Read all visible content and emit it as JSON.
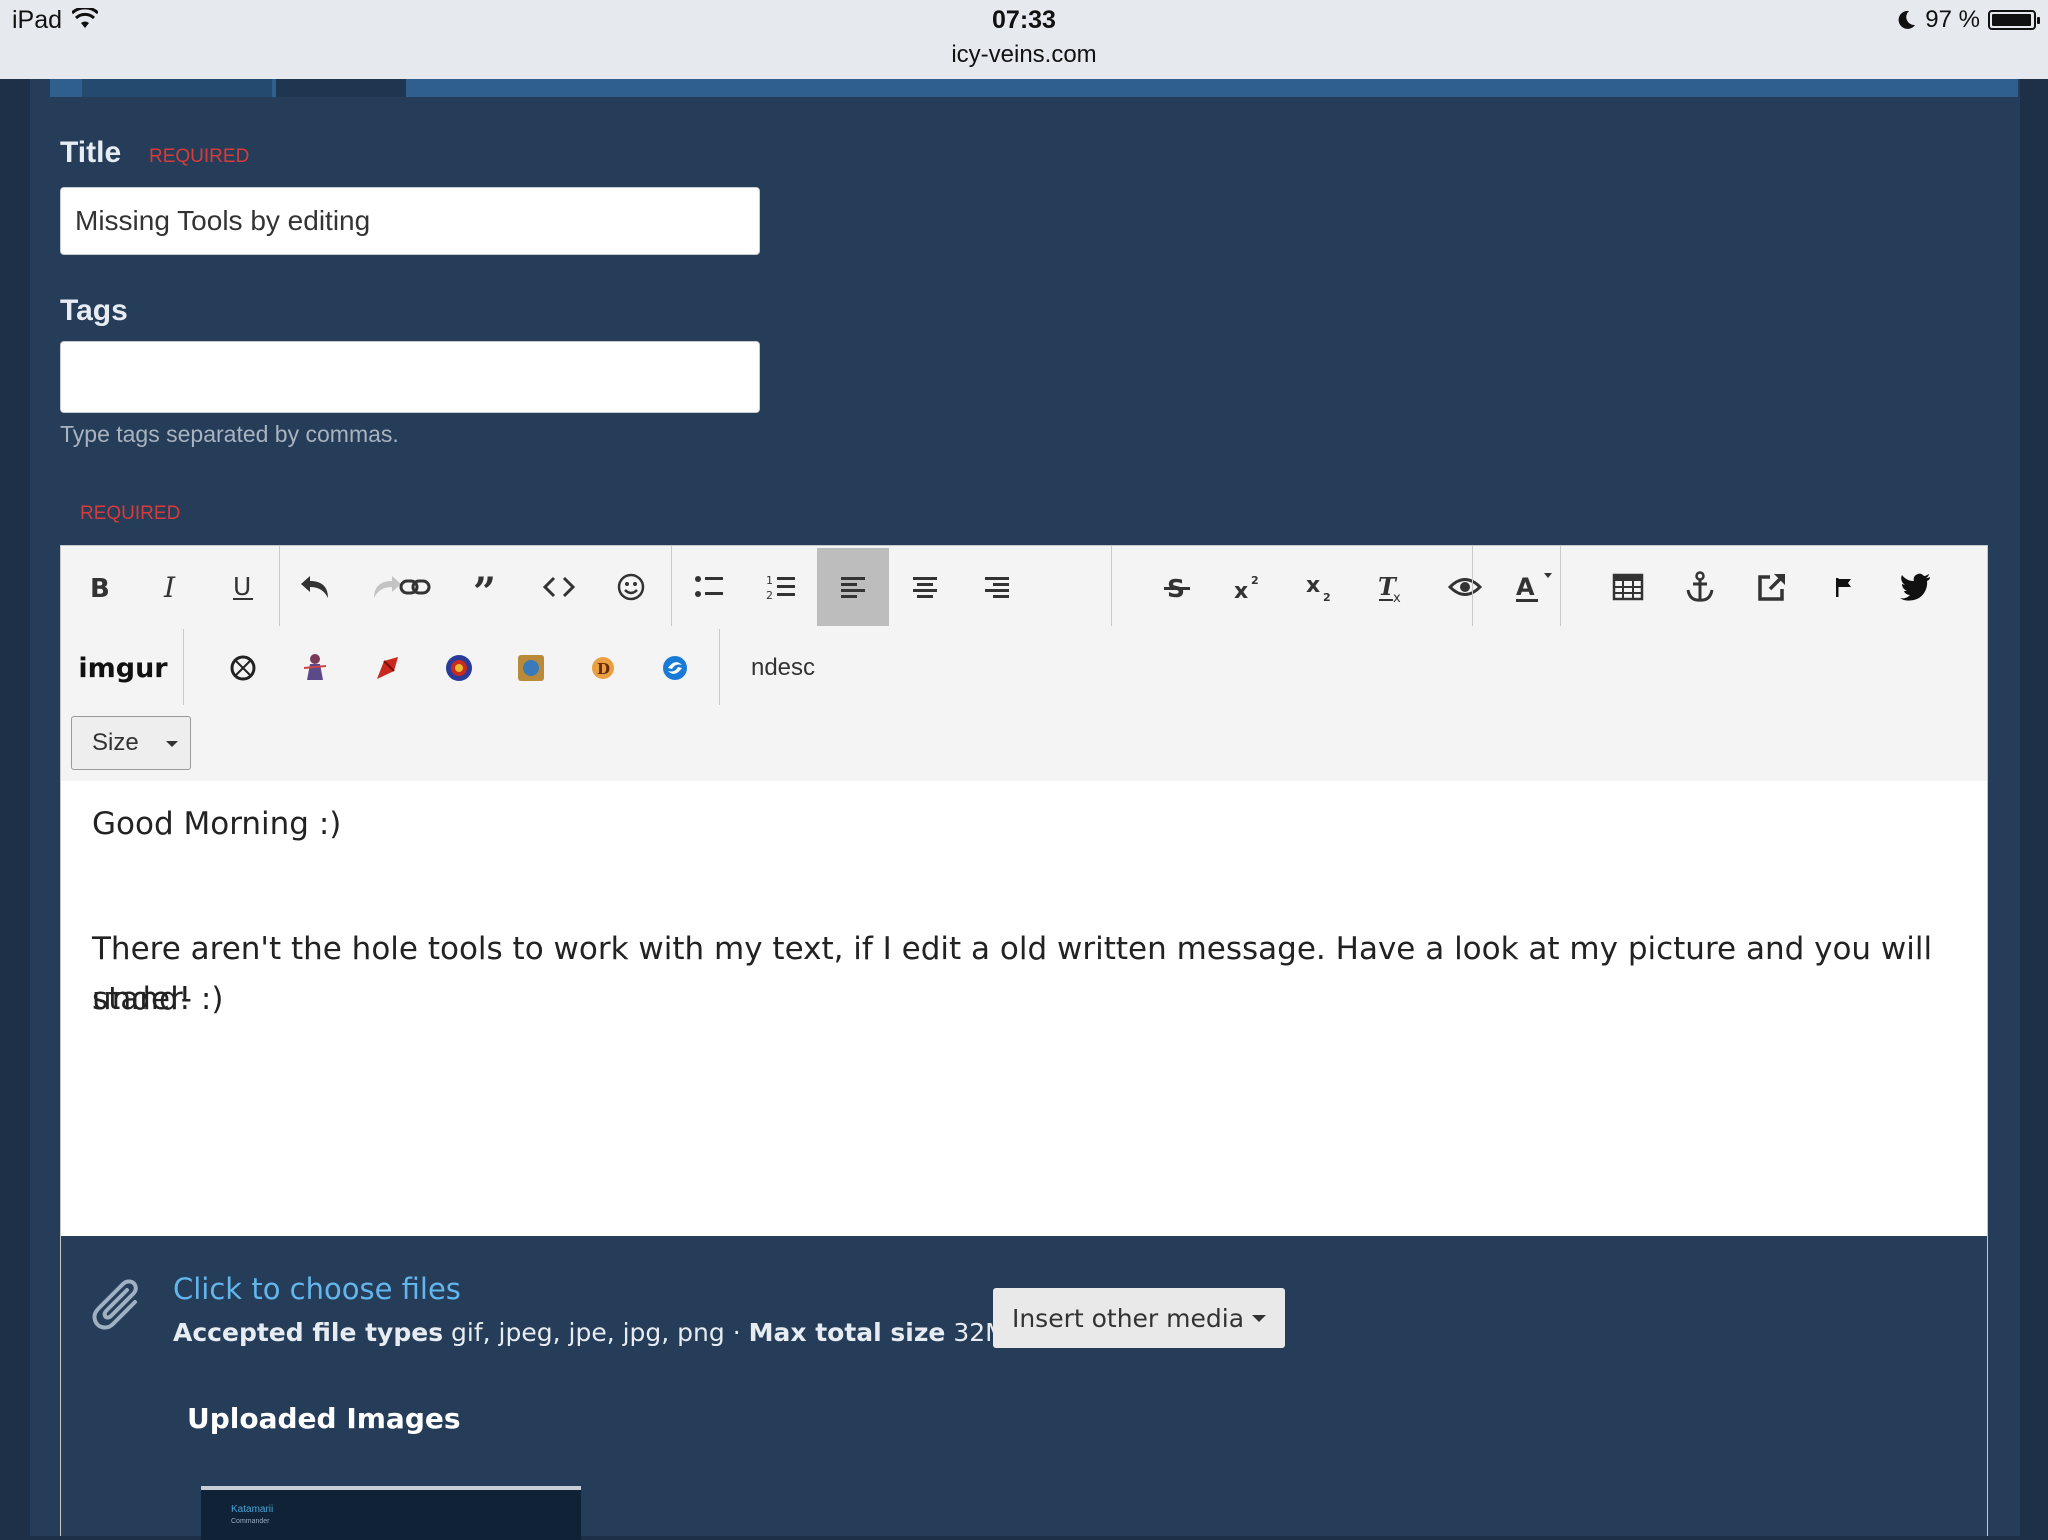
{
  "status_bar": {
    "device": "iPad",
    "time": "07:33",
    "url": "icy-veins.com",
    "battery": "97 %",
    "battery_level": 0.97
  },
  "form": {
    "title_label": "Title",
    "title_required": "REQUIRED",
    "title_value": "Missing Tools by editing",
    "tags_label": "Tags",
    "tags_value": "",
    "tags_hint": "Type tags separated by commas.",
    "content_required": "REQUIRED"
  },
  "toolbar": {
    "row1": [
      "bold-icon",
      "italic-icon",
      "underline-icon",
      "undo-icon",
      "redo-icon",
      "link-icon",
      "quote-icon",
      "code-icon",
      "emoji-icon",
      "bullet-list-icon",
      "numbered-list-icon",
      "align-left-icon",
      "align-center-icon",
      "align-right-icon",
      "strikethrough-icon",
      "superscript-icon",
      "subscript-icon",
      "remove-format-icon",
      "preview-icon",
      "text-color-icon",
      "table-icon",
      "anchor-icon",
      "external-link-icon",
      "flag-icon",
      "twitter-icon"
    ],
    "imgur_label": "imgur",
    "game_icons": [
      "overwatch-icon",
      "heroes-icon",
      "wow-icon",
      "warcraft-icon",
      "hearthstone-icon",
      "diablo-icon",
      "starcraft-icon"
    ],
    "ndesc_label": "ndesc",
    "size_label": "Size"
  },
  "editor": {
    "paragraph1": "Good Morning :)",
    "paragraph2_line1": "There aren't the hole tools to work with my text, if I edit a old written message. Have a look at my picture and you will under-",
    "paragraph2_line2": "stand! :)"
  },
  "attachments": {
    "choose_files": "Click to choose files",
    "accepted_label": "Accepted file types",
    "accepted_types": "gif, jpeg, jpe, jpg, png",
    "separator": "·",
    "max_label": "Max total size",
    "max_value": "32MB",
    "insert_media": "Insert other media",
    "uploaded_title": "Uploaded Images",
    "thumb_title": "Katamarii",
    "thumb_sub": "Commander"
  },
  "colors": {
    "page_bg": "#253d58",
    "link": "#63b6ec",
    "required": "#d93a3a",
    "active_tool": "#bdbdbd"
  }
}
